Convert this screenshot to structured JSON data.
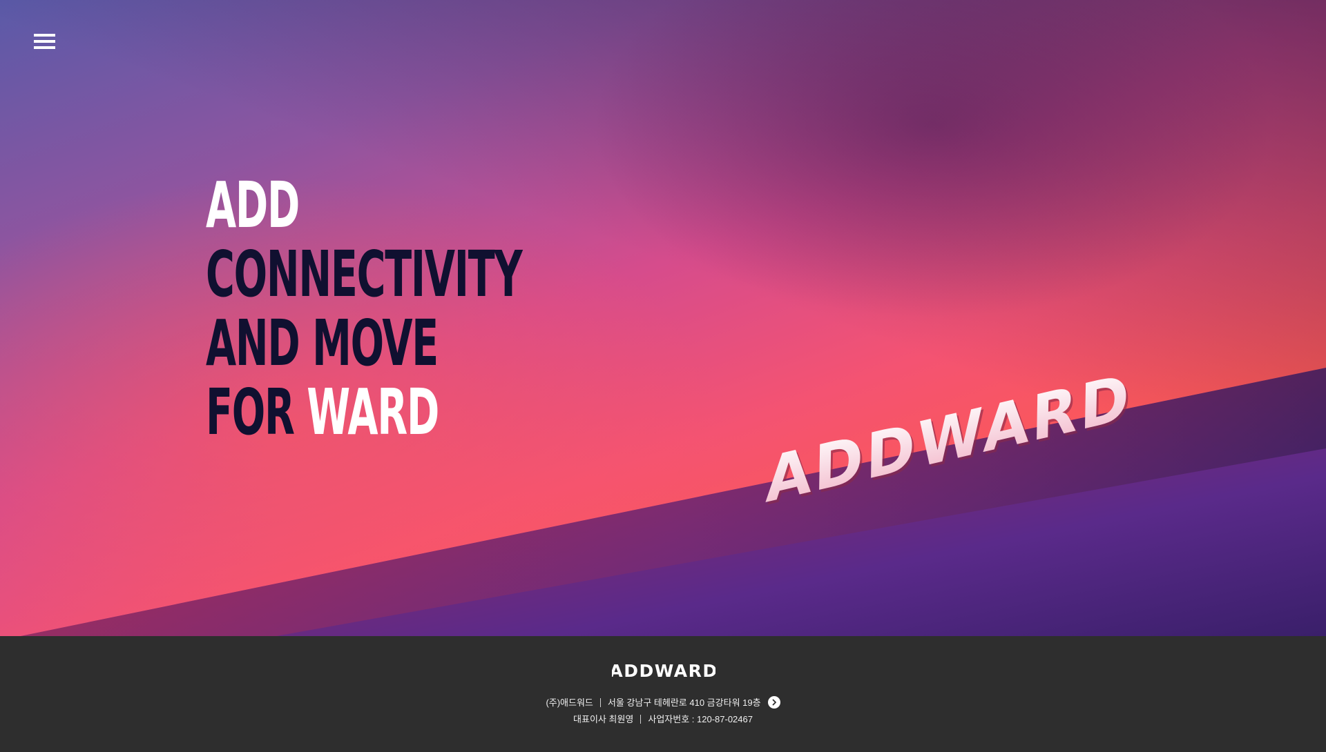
{
  "hero": {
    "headline": {
      "line1": "ADD",
      "line2": "CONNECTIVITY",
      "line3": "AND MOVE",
      "line4_dark": "FOR ",
      "line4_white": "WARD"
    },
    "brand_3d_text": "ADDWARD"
  },
  "menu": {
    "icon": "hamburger-icon"
  },
  "footer": {
    "logo_text": "ADDWARD",
    "company": "(주)애드워드",
    "address": "서울 강남구 테헤란로 410 금강타워 19층",
    "address_link_icon": "chevron-right-icon",
    "ceo": "대표이사 최원영",
    "business_number": "사업자번호 : 120-87-02467"
  },
  "colors": {
    "headline_white": "#ffffff",
    "headline_dark": "#101030",
    "footer_bg": "#2e2e2e"
  }
}
